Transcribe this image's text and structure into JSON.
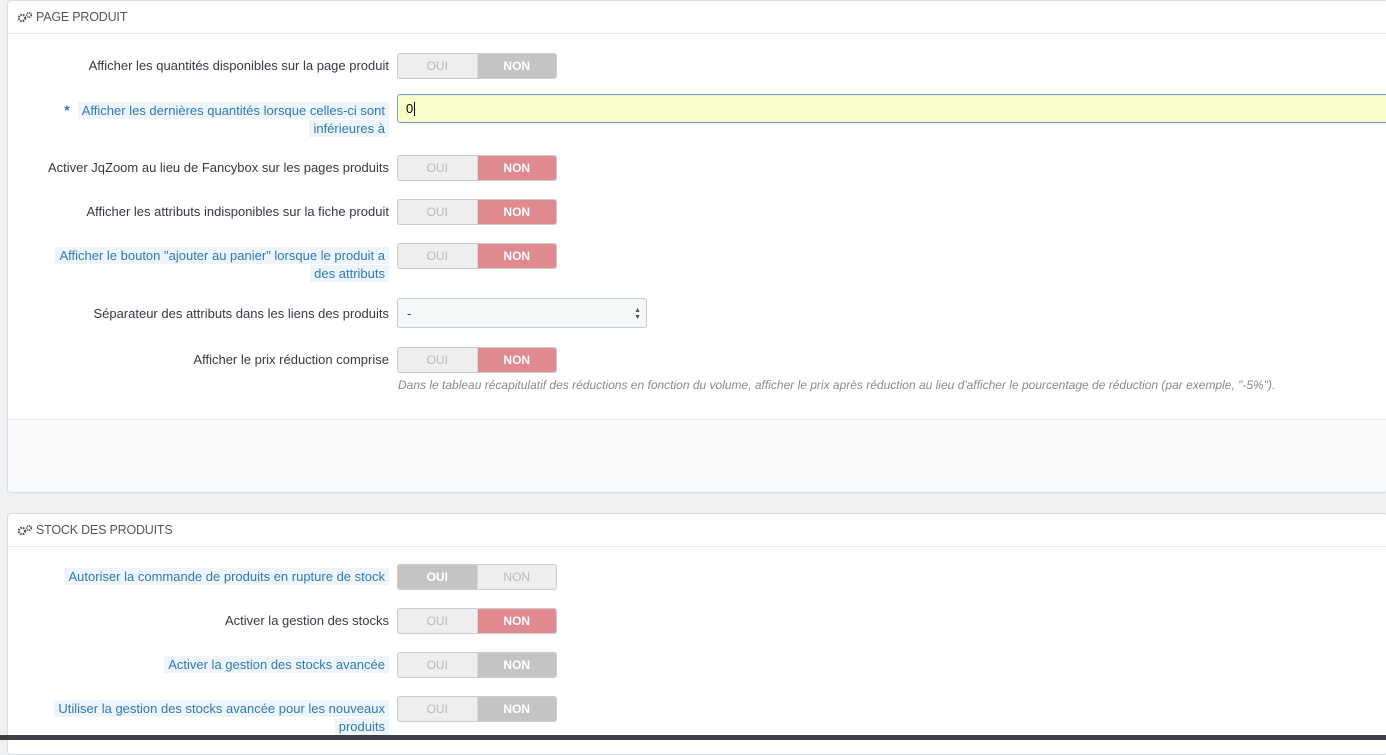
{
  "panel1": {
    "title": "PAGE PRODUIT",
    "rows": [
      {
        "label": "Afficher les quantités disponibles sur la page produit",
        "oui": "OUI",
        "non": "NON"
      },
      {
        "label_line1": "Afficher les dernières quantités lorsque celles-ci sont",
        "label_line2": "inférieures à",
        "value": "0",
        "required": "*"
      },
      {
        "label": "Activer JqZoom au lieu de Fancybox sur les pages produits",
        "oui": "OUI",
        "non": "NON"
      },
      {
        "label": "Afficher les attributs indisponibles sur la fiche produit",
        "oui": "OUI",
        "non": "NON"
      },
      {
        "label_line1": "Afficher le bouton \"ajouter au panier\" lorsque le produit a",
        "label_line2": "des attributs",
        "oui": "OUI",
        "non": "NON"
      },
      {
        "label": "Séparateur des attributs dans les liens des produits",
        "selected": "-"
      },
      {
        "label": "Afficher le prix réduction comprise",
        "oui": "OUI",
        "non": "NON",
        "help": "Dans le tableau récapitulatif des réductions en fonction du volume, afficher le prix après réduction au lieu d'afficher le pourcentage de réduction (par exemple, \"-5%\")."
      }
    ]
  },
  "panel2": {
    "title": "STOCK DES PRODUITS",
    "rows": [
      {
        "label": "Autoriser la commande de produits en rupture de stock",
        "oui": "OUI",
        "non": "NON"
      },
      {
        "label": "Activer la gestion des stocks",
        "oui": "OUI",
        "non": "NON"
      },
      {
        "label": "Activer la gestion des stocks avancée",
        "oui": "OUI",
        "non": "NON"
      },
      {
        "label_line1": "Utiliser la gestion des stocks avancée pour les nouveaux",
        "label_line2": "produits",
        "oui": "OUI",
        "non": "NON"
      }
    ]
  },
  "colors": {
    "toggle_active_red": "#e0898f",
    "toggle_active_grey": "#c4c4c4",
    "input_bg": "#fafcc8",
    "hint_text": "#2e7ab8"
  },
  "icons": {
    "panel_heading": "cogs-icon",
    "select_arrows": "sort-arrows-icon"
  }
}
